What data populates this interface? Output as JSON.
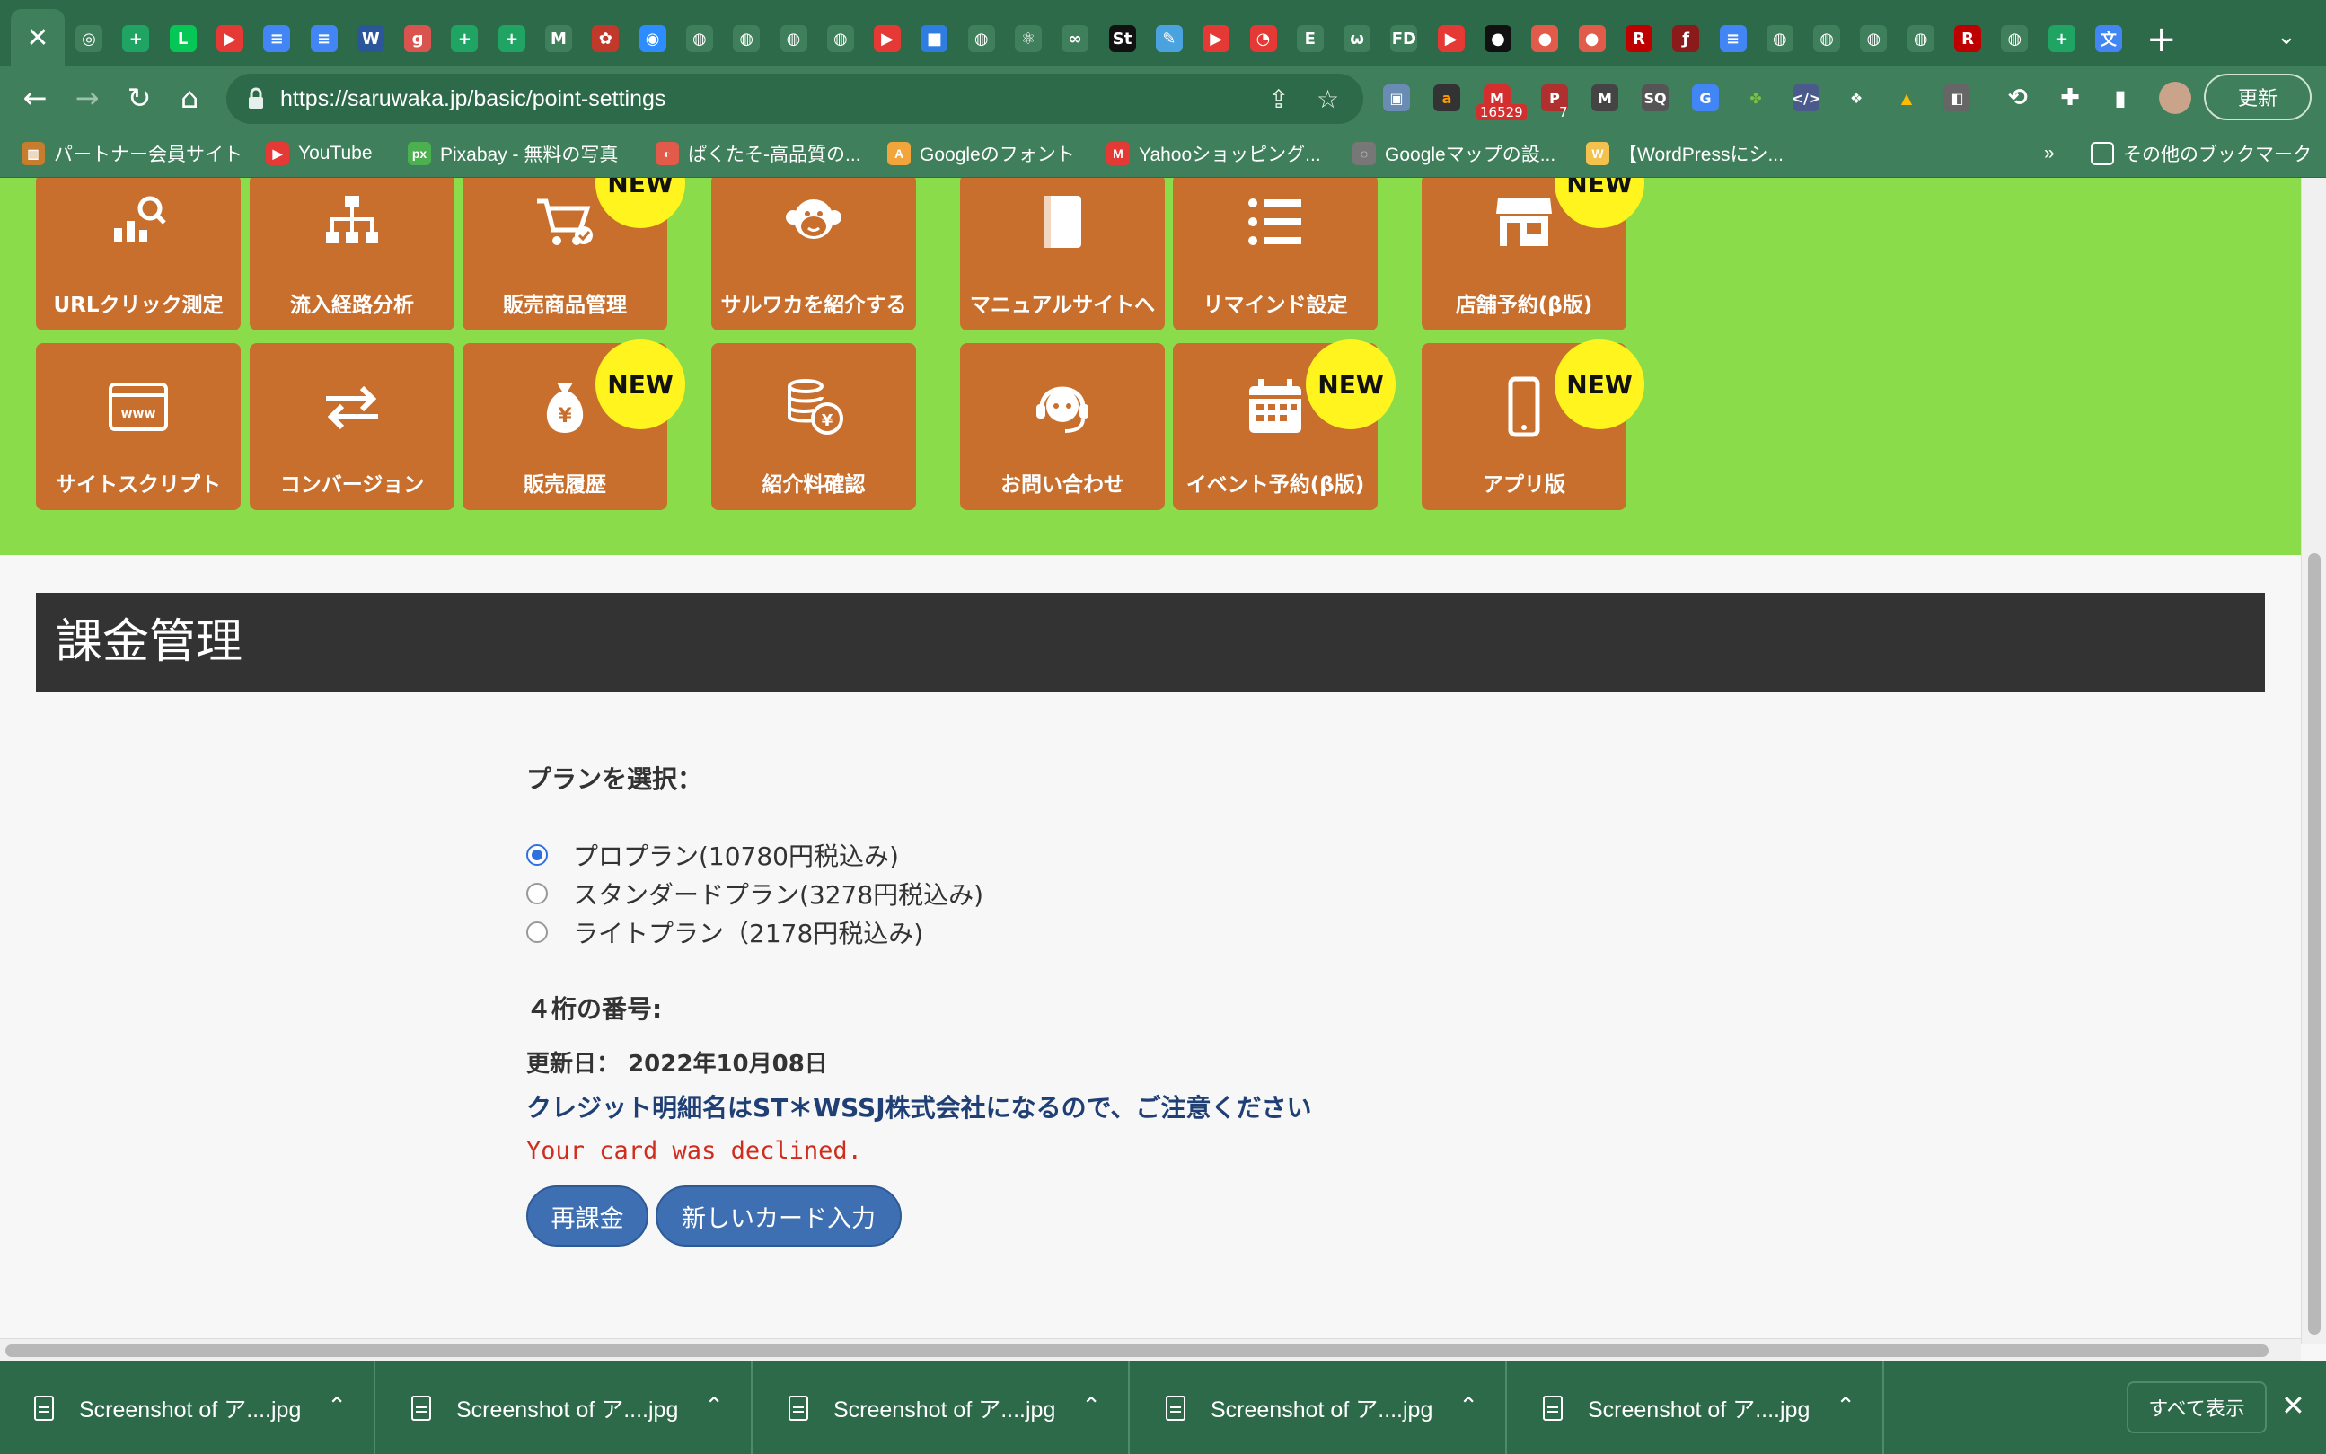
{
  "browser": {
    "url": "https://saruwaka.jp/basic/point-settings",
    "update_label": "更新",
    "ext_badge_count": "16529",
    "ext_badge_count2": "7",
    "bookmarks": [
      {
        "label": "パートナー会員サイト",
        "color": "#c77d2e"
      },
      {
        "label": "YouTube",
        "color": "#e53935"
      },
      {
        "label": "Pixabay - 無料の写真",
        "color": "#4caf50"
      },
      {
        "label": "ぱくたそ-高品質の...",
        "color": "#e25a4a"
      },
      {
        "label": "Googleのフォント",
        "color": "#f2a53a"
      },
      {
        "label": "Yahooショッピング...",
        "color": "#e53935"
      },
      {
        "label": "Googleマップの設...",
        "color": "#777777"
      },
      {
        "label": "【WordPressにシ...",
        "color": "#f2c14e"
      }
    ],
    "bookmarks_more": "»",
    "other_bookmarks": "その他のブックマーク"
  },
  "tiles": {
    "row1": [
      {
        "label": "URLクリック測定",
        "icon": "chart-search-icon",
        "badge": ""
      },
      {
        "label": "流入経路分析",
        "icon": "sitemap-icon",
        "badge": ""
      },
      {
        "label": "販売商品管理",
        "icon": "cart-check-icon",
        "badge": "NEW"
      },
      {
        "label": "サルワカを紹介する",
        "icon": "monkey-icon",
        "badge": ""
      },
      {
        "label": "マニュアルサイトへ",
        "icon": "book-icon",
        "badge": ""
      },
      {
        "label": "リマインド設定",
        "icon": "list-icon",
        "badge": ""
      },
      {
        "label": "店舗予約(β版)",
        "icon": "store-icon",
        "badge": "NEW"
      }
    ],
    "row2": [
      {
        "label": "サイトスクリプト",
        "icon": "www-window-icon",
        "badge": ""
      },
      {
        "label": "コンバージョン",
        "icon": "exchange-arrows-icon",
        "badge": ""
      },
      {
        "label": "販売履歴",
        "icon": "money-bag-icon",
        "badge": "NEW"
      },
      {
        "label": "紹介料確認",
        "icon": "coins-yen-icon",
        "badge": ""
      },
      {
        "label": "お問い合わせ",
        "icon": "headset-icon",
        "badge": ""
      },
      {
        "label": "イベント予約(β版)",
        "icon": "calendar-icon",
        "badge": "NEW"
      },
      {
        "label": "アプリ版",
        "icon": "smartphone-icon",
        "badge": "NEW"
      }
    ]
  },
  "billing": {
    "title": "課金管理",
    "plan_prompt": "プランを選択：",
    "plans": [
      {
        "label": "プロプラン(10780円税込み)",
        "selected": true
      },
      {
        "label": "スタンダードプラン(3278円税込み)",
        "selected": false
      },
      {
        "label": "ライトプラン（2178円税込み)",
        "selected": false
      }
    ],
    "four_digit_label": "４桁の番号:",
    "update_date_label": "更新日：",
    "update_date_value": "2022年10月08日",
    "credit_notice": "クレジット明細名はST＊WSSJ株式会社になるので、ご注意ください",
    "error_message": "Your card was declined.",
    "recharge_button": "再課金",
    "new_card_button": "新しいカード入力"
  },
  "downloads": {
    "items": [
      "Screenshot of ア....jpg",
      "Screenshot of ア....jpg",
      "Screenshot of ア....jpg",
      "Screenshot of ア....jpg",
      "Screenshot of ア....jpg"
    ],
    "show_all": "すべて表示"
  }
}
